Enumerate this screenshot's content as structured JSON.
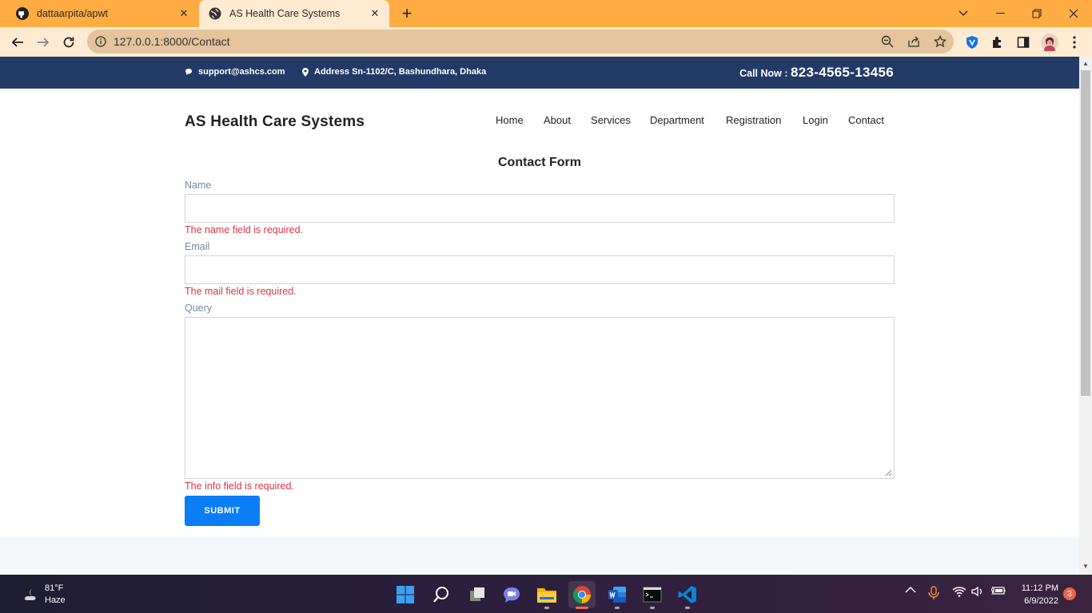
{
  "browser": {
    "tabs": [
      {
        "title": "dattaarpita/apwt",
        "icon": "github-icon"
      },
      {
        "title": "AS Health Care Systems",
        "icon": "globe-icon"
      }
    ],
    "url": "127.0.0.1:8000/Contact",
    "accent": "#ffad42"
  },
  "topbar": {
    "email": "support@ashcs.com",
    "address": "Address Sn-1102/C, Bashundhara, Dhaka",
    "call_label": "Call Now : ",
    "call_number": "823-4565-13456",
    "bg": "#223a66"
  },
  "header": {
    "brand": "AS Health Care Systems",
    "nav": [
      "Home",
      "About",
      "Services",
      "Department",
      "Registration",
      "Login",
      "Contact"
    ]
  },
  "form": {
    "title": "Contact Form",
    "name_label": "Name",
    "name_value": "",
    "name_error": "The name field is required.",
    "email_label": "Email",
    "email_value": "",
    "email_error": "The mail field is required.",
    "query_label": "Query",
    "query_value": "",
    "query_error": "The info field is required.",
    "submit_label": "SUBMIT",
    "error_color": "#dc3545",
    "button_color": "#0b7df5"
  },
  "taskbar": {
    "weather_temp": "81°F",
    "weather_desc": "Haze",
    "time": "11:12 PM",
    "date": "6/9/2022",
    "notifications": "3"
  }
}
